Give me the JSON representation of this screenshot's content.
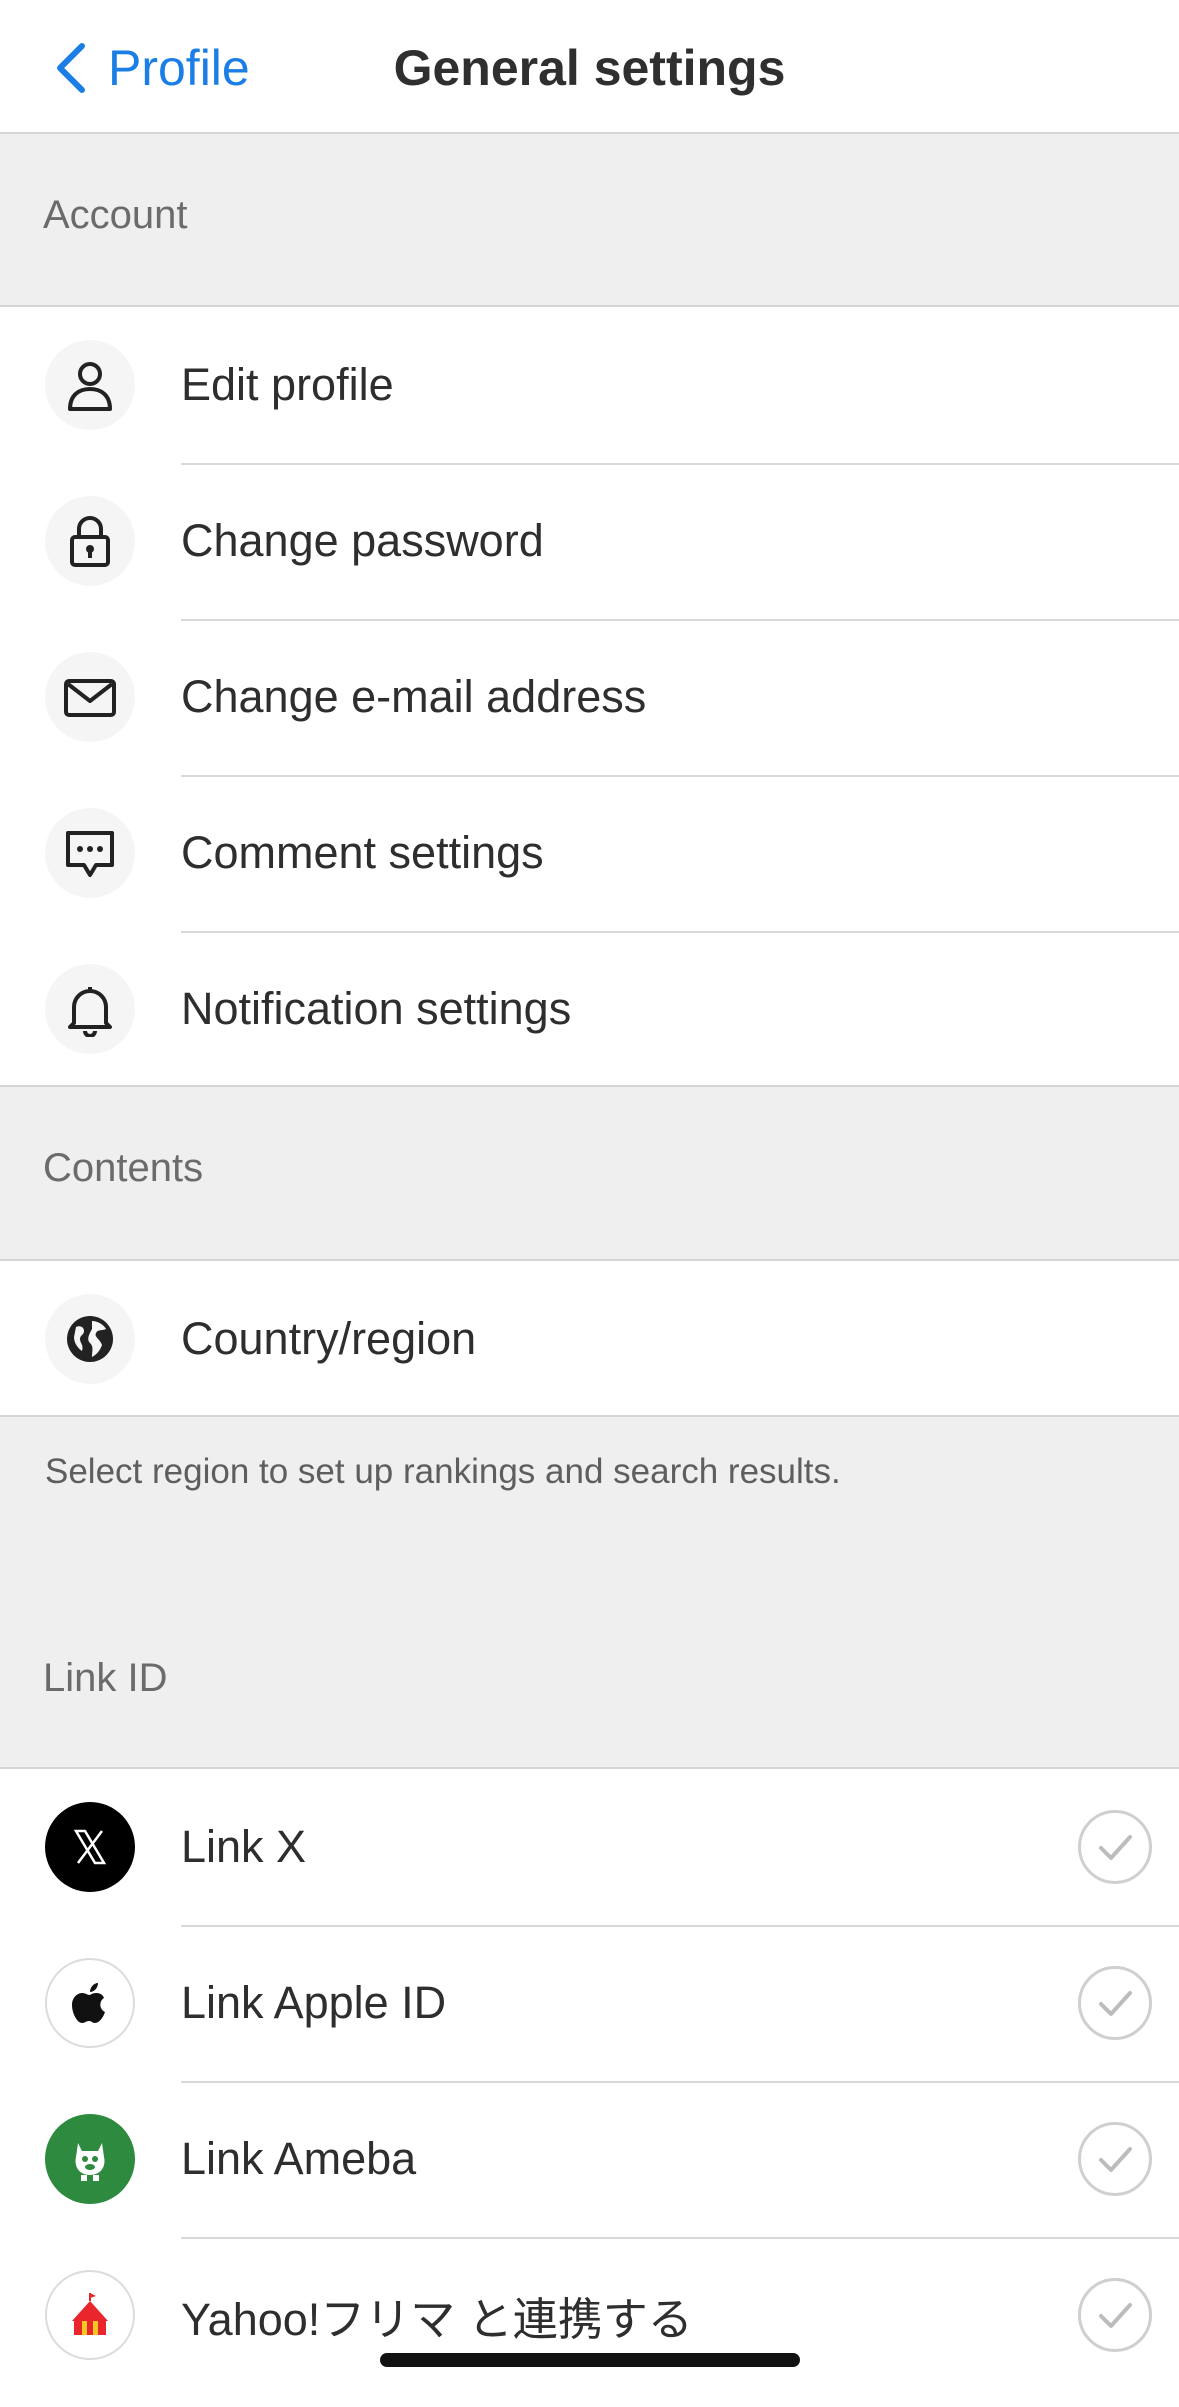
{
  "nav": {
    "back_label": "Profile",
    "title": "General settings"
  },
  "sections": {
    "account": {
      "header": "Account",
      "items": [
        {
          "label": "Edit profile",
          "icon": "person-icon"
        },
        {
          "label": "Change password",
          "icon": "lock-icon"
        },
        {
          "label": "Change e-mail address",
          "icon": "envelope-icon"
        },
        {
          "label": "Comment settings",
          "icon": "comment-bubble-icon"
        },
        {
          "label": "Notification settings",
          "icon": "bell-icon"
        }
      ]
    },
    "contents": {
      "header": "Contents",
      "items": [
        {
          "label": "Country/region",
          "icon": "globe-icon"
        }
      ],
      "footnote": "Select region to set up rankings and search results."
    },
    "link_id": {
      "header": "Link ID",
      "items": [
        {
          "label": "Link X",
          "icon": "x-logo-icon",
          "status": "check-icon"
        },
        {
          "label": "Link Apple ID",
          "icon": "apple-logo-icon",
          "status": "check-icon"
        },
        {
          "label": "Link Ameba",
          "icon": "ameba-logo-icon",
          "status": "check-icon"
        },
        {
          "label": "Yahoo!フリマ と連携する",
          "icon": "yahoo-flea-market-icon",
          "status": "check-icon"
        }
      ]
    }
  },
  "colors": {
    "accent": "#1a7ee6",
    "background": "#efefef",
    "x_logo_bg": "#000000",
    "ameba_bg": "#2d8a3e",
    "yahoo_red": "#e8262c"
  }
}
